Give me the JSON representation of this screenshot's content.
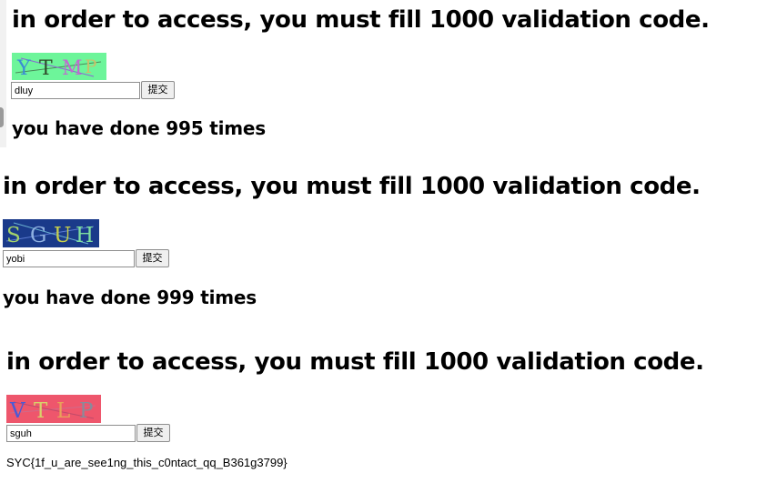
{
  "panels": [
    {
      "heading": "in order to access, you must fill 1000 validation code.",
      "captcha": {
        "letters": [
          "Y",
          "T",
          "M",
          "P"
        ],
        "bg_color": "#6df59a",
        "letter_colors": [
          "#3a8bd6",
          "#2f4a2a",
          "#c06ad0",
          "#c9c06a"
        ]
      },
      "input_value": "dluy",
      "submit_label": "提交",
      "status": "you have done 995 times"
    },
    {
      "heading": "in order to access, you must fill 1000 validation code.",
      "captcha": {
        "letters": [
          "S",
          "G",
          "U",
          "H"
        ],
        "bg_color": "#1a3a8a",
        "letter_colors": [
          "#a3d26a",
          "#8fb0e0",
          "#c8d04a",
          "#7fe0a0"
        ]
      },
      "input_value": "yobi",
      "submit_label": "提交",
      "status": "you have done 999 times"
    },
    {
      "heading": "in order to access, you must fill 1000 validation code.",
      "captcha": {
        "letters": [
          "V",
          "T",
          "L",
          "P"
        ],
        "bg_color": "#ee566c",
        "letter_colors": [
          "#4a5ad6",
          "#d8d06a",
          "#e8a05a",
          "#8a8a9a"
        ]
      },
      "input_value": "sguh",
      "submit_label": "提交",
      "flag": "SYC{1f_u_are_see1ng_this_c0ntact_qq_B361g3799}"
    }
  ]
}
